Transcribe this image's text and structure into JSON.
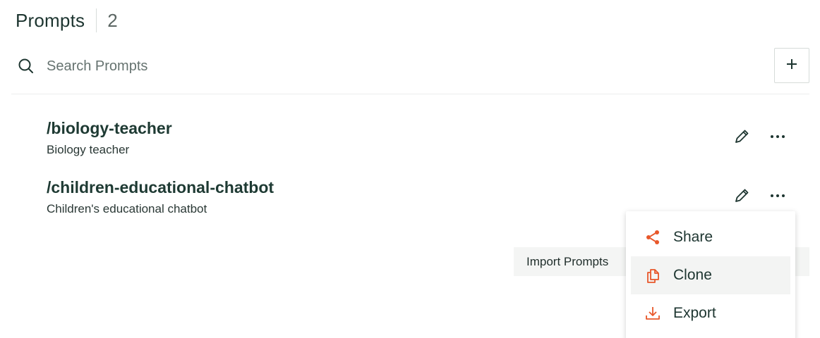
{
  "header": {
    "title": "Prompts",
    "count": "2"
  },
  "search": {
    "placeholder": "Search Prompts",
    "value": ""
  },
  "prompts": [
    {
      "name": "/biology-teacher",
      "description": "Biology teacher"
    },
    {
      "name": "/children-educational-chatbot",
      "description": "Children's educational chatbot"
    }
  ],
  "footer": {
    "import_label": "Import Prompts"
  },
  "context_menu": {
    "items": [
      {
        "label": "Share",
        "icon": "share-icon"
      },
      {
        "label": "Clone",
        "icon": "clone-icon"
      },
      {
        "label": "Export",
        "icon": "export-icon"
      }
    ]
  },
  "colors": {
    "accent": "#e8572a",
    "text": "#1d3530",
    "hover": "#f3f4f3"
  }
}
